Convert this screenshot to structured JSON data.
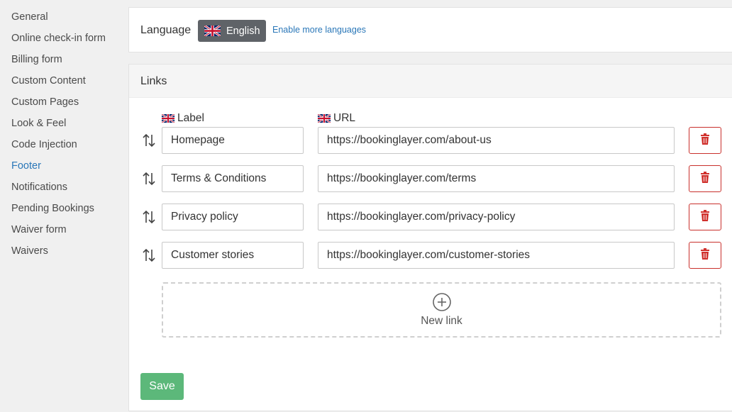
{
  "sidebar": {
    "items": [
      {
        "label": "General",
        "active": false
      },
      {
        "label": "Online check-in form",
        "active": false
      },
      {
        "label": "Billing form",
        "active": false
      },
      {
        "label": "Custom Content",
        "active": false
      },
      {
        "label": "Custom Pages",
        "active": false
      },
      {
        "label": "Look & Feel",
        "active": false
      },
      {
        "label": "Code Injection",
        "active": false
      },
      {
        "label": "Footer",
        "active": true
      },
      {
        "label": "Notifications",
        "active": false
      },
      {
        "label": "Pending Bookings",
        "active": false
      },
      {
        "label": "Waiver form",
        "active": false
      },
      {
        "label": "Waivers",
        "active": false
      }
    ],
    "active_color": "#2a77b8"
  },
  "language": {
    "label": "Language",
    "selected": "English",
    "flag_icon": "uk-flag-icon",
    "enable_more_link": "Enable more languages"
  },
  "links": {
    "title": "Links",
    "label_column": "Label",
    "url_column": "URL",
    "rows": [
      {
        "label": "Homepage",
        "url": "https://bookinglayer.com/about-us"
      },
      {
        "label": "Terms & Conditions",
        "url": "https://bookinglayer.com/terms"
      },
      {
        "label": "Privacy policy",
        "url": "https://bookinglayer.com/privacy-policy"
      },
      {
        "label": "Customer stories",
        "url": "https://bookinglayer.com/customer-stories"
      }
    ],
    "new_link_label": "New link",
    "sort_icon": "sort-arrows-icon",
    "delete_icon": "trash-icon"
  },
  "save_label": "Save",
  "colors": {
    "save": "#5cb87a",
    "delete": "#c9302c",
    "language_button": "#5f6368"
  }
}
